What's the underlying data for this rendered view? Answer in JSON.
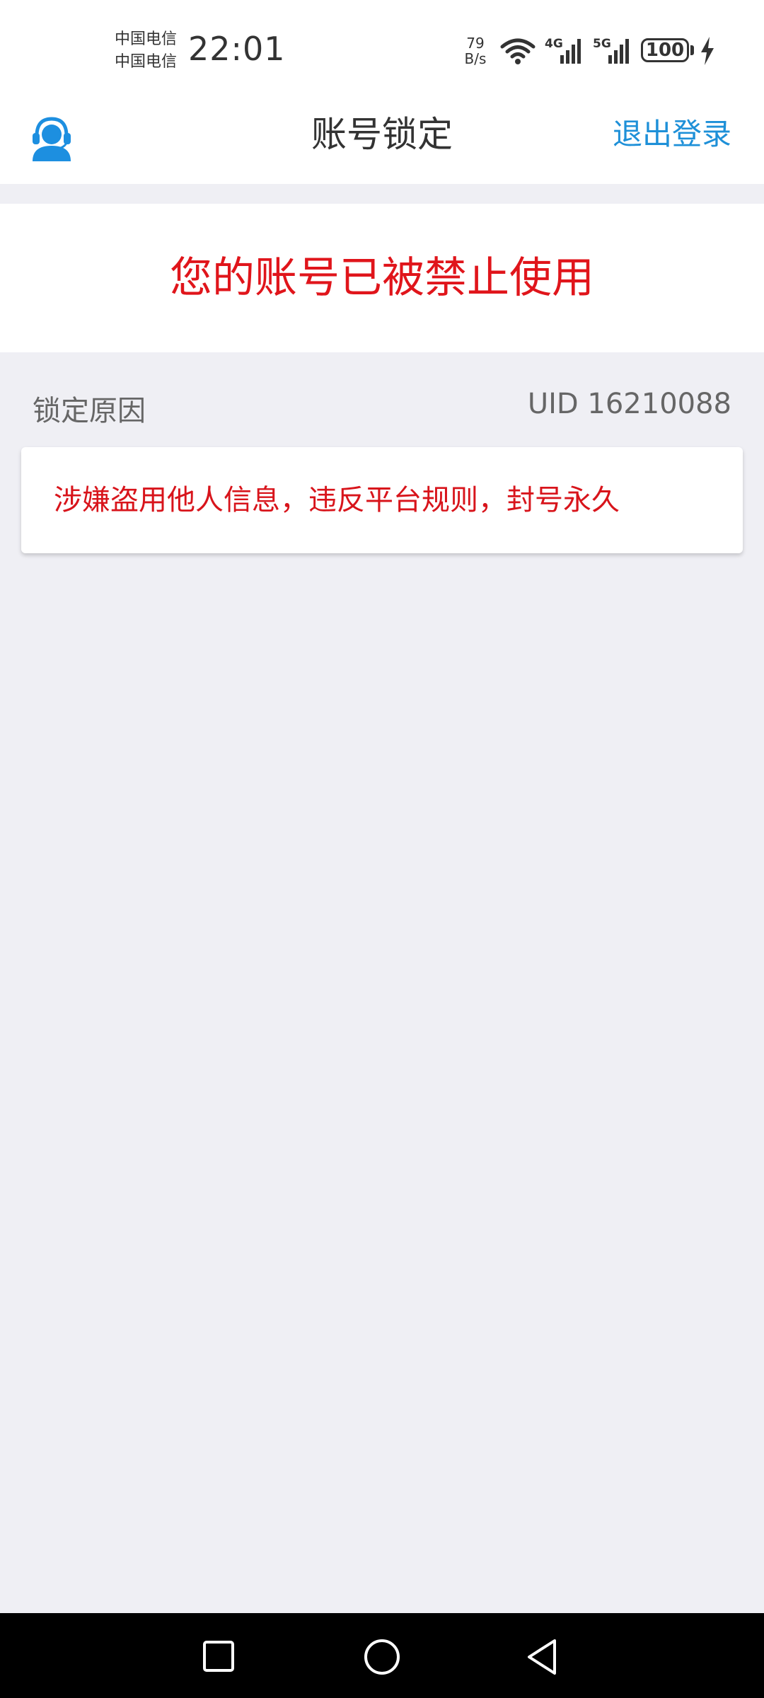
{
  "status_bar": {
    "carrier_1": "中国电信",
    "carrier_2": "中国电信",
    "time": "22:01",
    "net_speed_value": "79",
    "net_speed_unit": "B/s",
    "signal_1_label": "4G",
    "signal_2_label": "5G",
    "battery": "100"
  },
  "header": {
    "title": "账号锁定",
    "logout_label": "退出登录",
    "service_icon": "customer-service-icon"
  },
  "banner": {
    "message": "您的账号已被禁止使用"
  },
  "reason": {
    "label": "锁定原因",
    "uid": "UID 16210088",
    "text": "涉嫌盗用他人信息，违反平台规则，封号永久"
  },
  "colors": {
    "accent": "#1e90d8",
    "alert": "#e0151b",
    "background": "#efeff4"
  }
}
